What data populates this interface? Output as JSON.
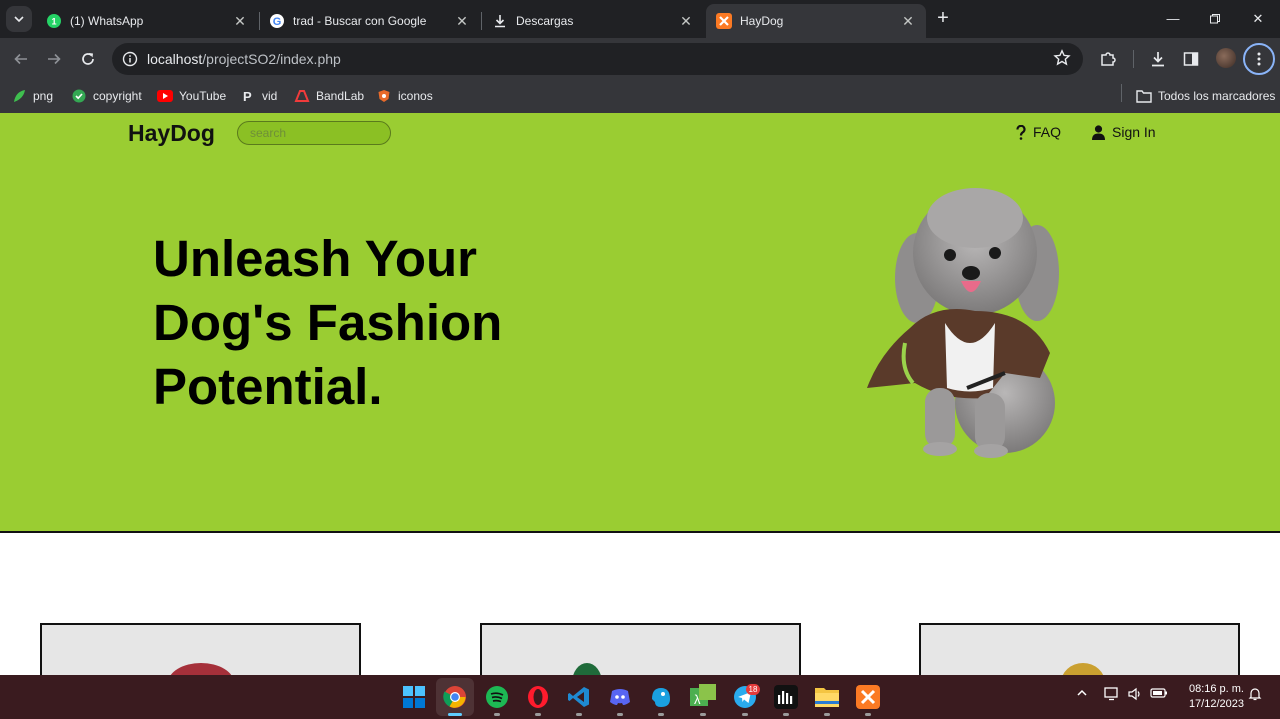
{
  "browser": {
    "tabs": [
      {
        "title": "(1) WhatsApp",
        "icon": "whatsapp-icon",
        "active": false
      },
      {
        "title": "trad - Buscar con Google",
        "icon": "google-icon",
        "active": false
      },
      {
        "title": "Descargas",
        "icon": "download-icon",
        "active": false
      },
      {
        "title": "HayDog",
        "icon": "xampp-icon",
        "active": true
      }
    ],
    "url_host": "localhost",
    "url_path": "/projectSO2/index.php",
    "bookmarks": [
      {
        "label": "png",
        "icon": "leaf-icon"
      },
      {
        "label": "copyright",
        "icon": "check-circle-icon"
      },
      {
        "label": "YouTube",
        "icon": "youtube-icon"
      },
      {
        "label": "vid",
        "icon": "p-logo-icon"
      },
      {
        "label": "BandLab",
        "icon": "bandlab-icon"
      },
      {
        "label": "iconos",
        "icon": "shield-icon"
      }
    ],
    "all_bookmarks_label": "Todos los marcadores"
  },
  "site": {
    "brand": "HayDog",
    "search_placeholder": "search",
    "nav": {
      "faq": "FAQ",
      "sign_in": "Sign In"
    },
    "headline": [
      "Unleash Your",
      "Dog's Fashion",
      "Potential."
    ],
    "accent_color": "#9acd32"
  },
  "taskbar": {
    "apps": [
      "windows-start-icon",
      "chrome-icon",
      "spotify-icon",
      "opera-icon",
      "vscode-icon",
      "discord-icon",
      "app-icon",
      "translator-icon",
      "telegram-icon",
      "audio-app-icon",
      "file-explorer-icon",
      "xampp-icon"
    ],
    "telegram_badge": "18",
    "time": "08:16 p. m.",
    "date": "17/12/2023"
  }
}
